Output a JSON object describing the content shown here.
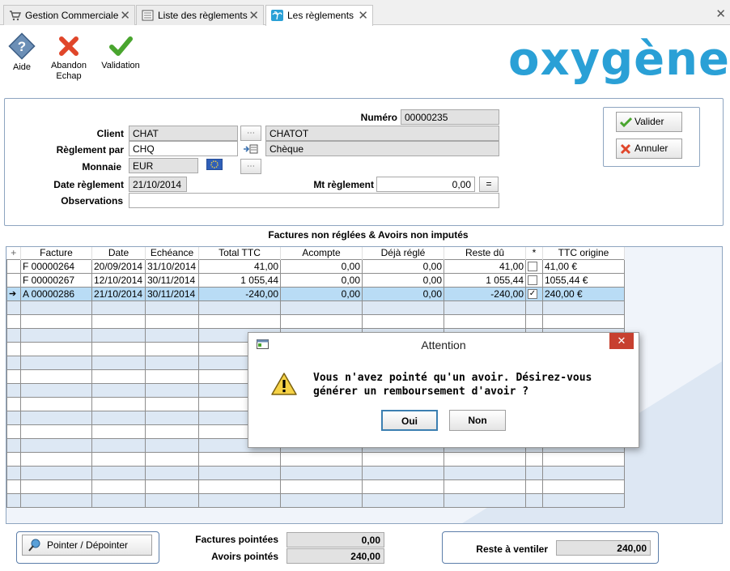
{
  "tabs": [
    {
      "label": "Gestion Commerciale"
    },
    {
      "label": "Liste des règlements"
    },
    {
      "label": "Les règlements"
    }
  ],
  "toolbar": {
    "help_label": "Aide",
    "abandon_label": "Abandon",
    "abandon_sub": "Echap",
    "validate_label": "Validation"
  },
  "logo_text": "oxygène",
  "form": {
    "numero_label": "Numéro",
    "numero_value": "00000235",
    "client_label": "Client",
    "client_code": "CHAT",
    "client_name": "CHATOT",
    "reglement_label": "Règlement par",
    "reglement_code": "CHQ",
    "reglement_name": "Chèque",
    "monnaie_label": "Monnaie",
    "monnaie_value": "EUR",
    "date_label": "Date règlement",
    "date_value": "21/10/2014",
    "mt_label": "Mt règlement",
    "mt_value": "0,00",
    "equals_label": "=",
    "observations_label": "Observations",
    "observations_value": ""
  },
  "actions": {
    "valider": "Valider",
    "annuler": "Annuler"
  },
  "grid": {
    "title": "Factures non réglées & Avoirs non imputés",
    "columns": [
      "Facture",
      "Date",
      "Echéance",
      "Total TTC",
      "Acompte",
      "Déjà réglé",
      "Reste dû",
      "*",
      "TTC origine"
    ],
    "rows": [
      {
        "facture": "F 00000264",
        "date": "20/09/2014",
        "echeance": "31/10/2014",
        "total": "41,00",
        "acompte": "0,00",
        "deja": "0,00",
        "reste": "41,00",
        "checked": "",
        "origine": "41,00 €"
      },
      {
        "facture": "F 00000267",
        "date": "12/10/2014",
        "echeance": "30/11/2014",
        "total": "1 055,44",
        "acompte": "0,00",
        "deja": "0,00",
        "reste": "1 055,44",
        "checked": "",
        "origine": "1055,44 €"
      },
      {
        "facture": "A 00000286",
        "date": "21/10/2014",
        "echeance": "30/11/2014",
        "total": "-240,00",
        "acompte": "0,00",
        "deja": "0,00",
        "reste": "-240,00",
        "checked": "✓",
        "origine": "240,00 €"
      }
    ]
  },
  "dialog": {
    "title": "Attention",
    "message": "Vous n'avez pointé qu'un avoir. Désirez-vous générer un remboursement d'avoir ?",
    "yes_label": "Oui",
    "no_label": "Non"
  },
  "bottom": {
    "pointer_label": "Pointer / Dépointer",
    "factures_label": "Factures pointées",
    "factures_value": "0,00",
    "avoirs_label": "Avoirs pointés",
    "avoirs_value": "240,00",
    "reste_label": "Reste à ventiler",
    "reste_value": "240,00"
  },
  "colors": {
    "accent": "#2aa0d6",
    "selected_row": "#b9dcf5",
    "panel_border": "#8ea5c0"
  }
}
